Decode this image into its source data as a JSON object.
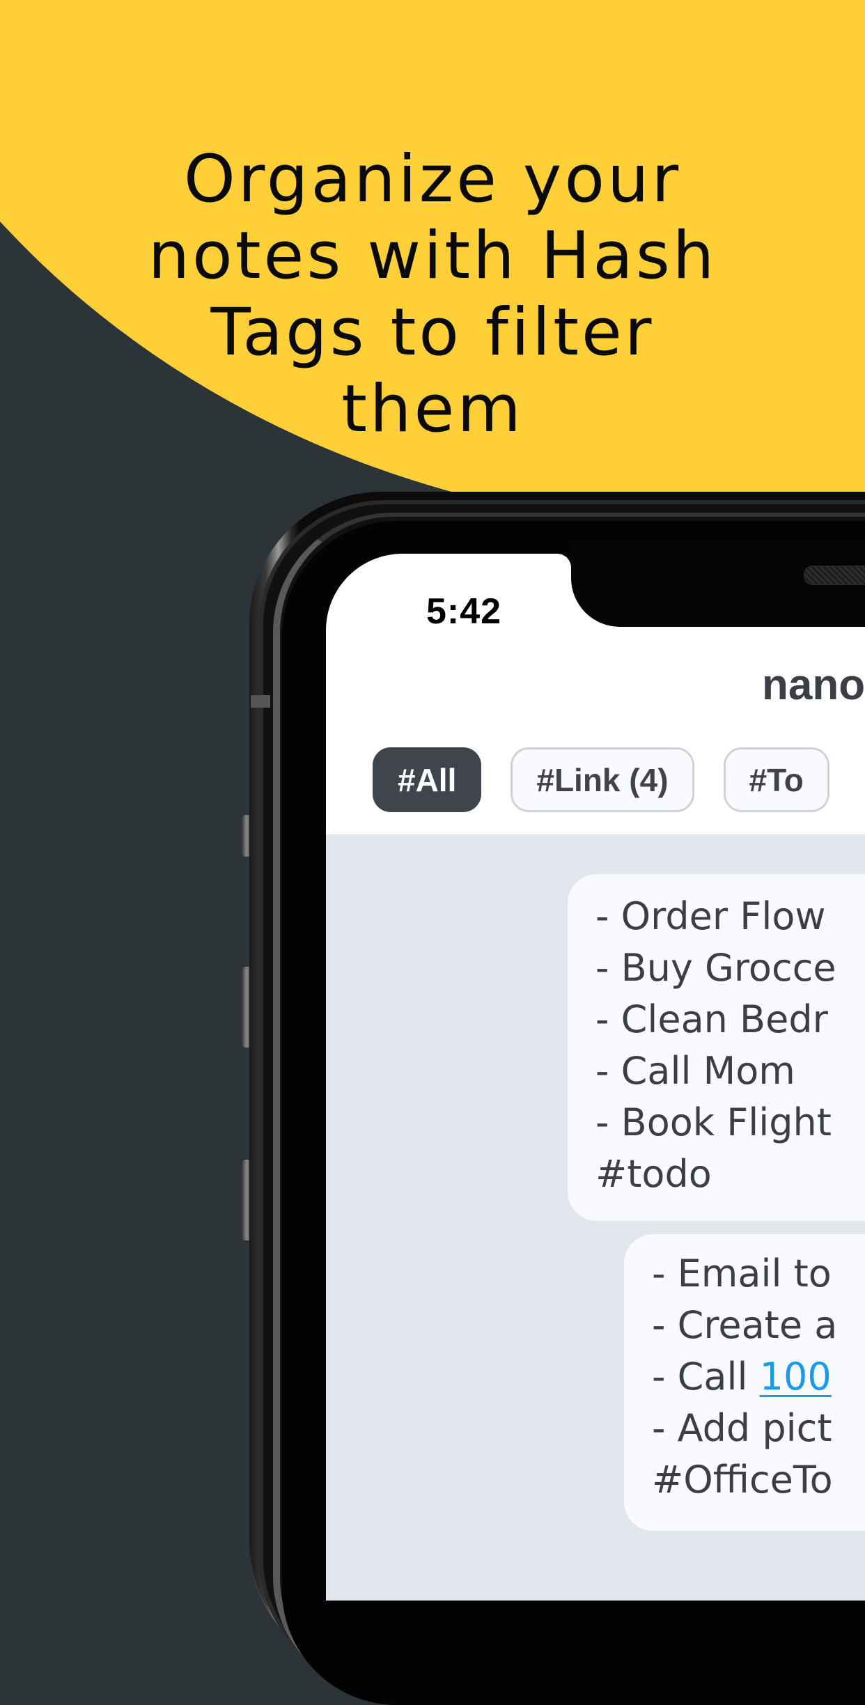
{
  "headline": {
    "lines": [
      "Organize your",
      "notes with Hash",
      "Tags to filter",
      "them"
    ]
  },
  "status_bar": {
    "time": "5:42"
  },
  "app": {
    "title": "nano"
  },
  "chips": [
    {
      "label": "#All",
      "active": true
    },
    {
      "label": "#Link (4)",
      "active": false
    },
    {
      "label": "#To",
      "active": false
    }
  ],
  "notes": [
    {
      "lines": [
        "- Order Flow",
        "- Buy Grocce",
        "- Clean Bedr",
        "- Call Mom",
        "- Book Flight"
      ],
      "tag": "#todo"
    },
    {
      "lines": [
        "- Email to",
        "- Create a"
      ],
      "call_prefix": "- Call ",
      "call_link": "100",
      "lines_after": [
        "- Add pict"
      ],
      "tag": "#OfficeTo"
    }
  ],
  "colors": {
    "yellow": "#FFCF38",
    "dark_bg": "#2C3437",
    "chip_active": "#40454C",
    "link": "#1A9BE8",
    "content_bg": "#E2E6EC"
  }
}
